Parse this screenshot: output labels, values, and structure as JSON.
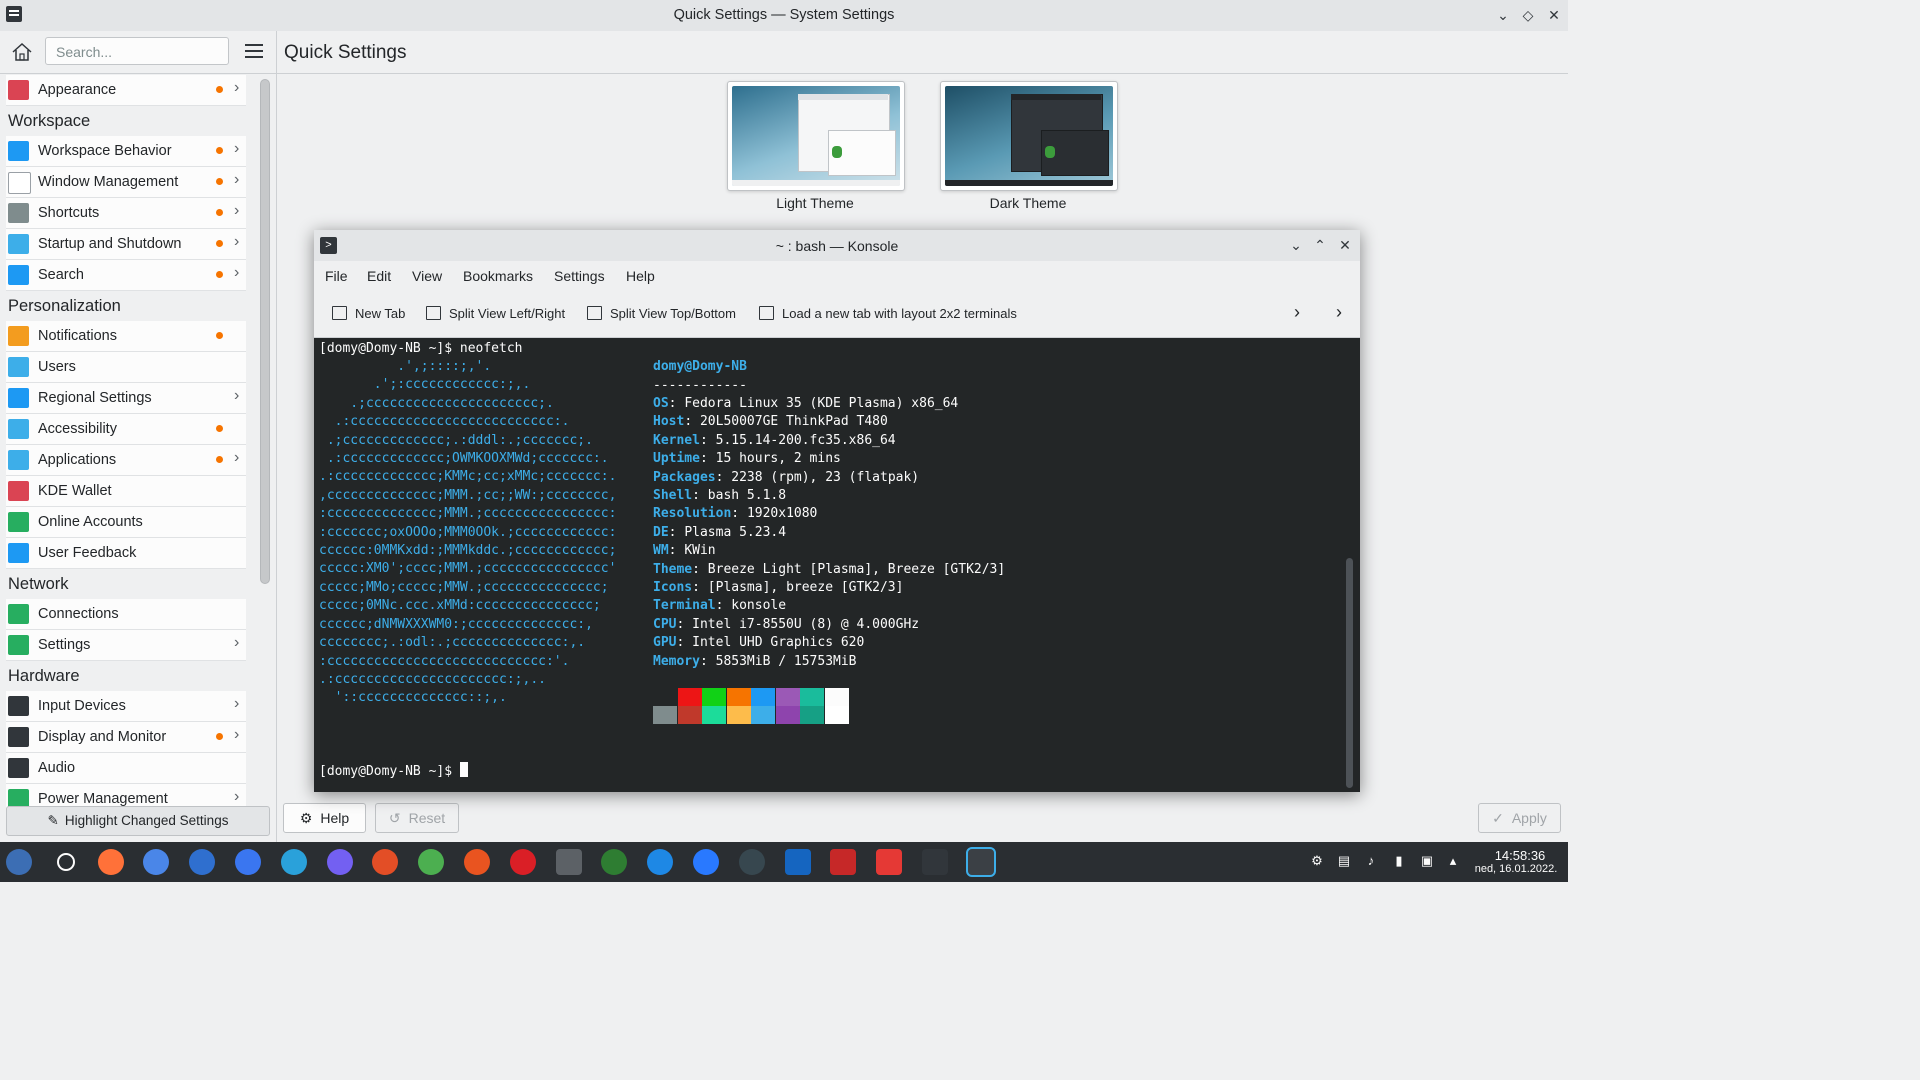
{
  "window": {
    "title": "Quick Settings — System Settings"
  },
  "sidebar": {
    "search_placeholder": "Search...",
    "sections": [
      {
        "heading": "",
        "items": [
          {
            "label": "Appearance",
            "dot": true,
            "chevron": true,
            "icon": "appearance-icon",
            "color": "#da4453"
          }
        ]
      },
      {
        "heading": "Workspace",
        "items": [
          {
            "label": "Workspace Behavior",
            "dot": true,
            "chevron": true,
            "icon": "workspace-icon",
            "color": "#1d99f3"
          },
          {
            "label": "Window Management",
            "dot": true,
            "chevron": true,
            "icon": "window-icon",
            "color": "#ffffff"
          },
          {
            "label": "Shortcuts",
            "dot": true,
            "chevron": true,
            "icon": "keyboard-icon",
            "color": "#7f8c8d"
          },
          {
            "label": "Startup and Shutdown",
            "dot": true,
            "chevron": true,
            "icon": "startup-icon",
            "color": "#3daee9"
          },
          {
            "label": "Search",
            "dot": true,
            "chevron": true,
            "icon": "search-icon",
            "color": "#1d99f3"
          }
        ]
      },
      {
        "heading": "Personalization",
        "items": [
          {
            "label": "Notifications",
            "dot": true,
            "chevron": false,
            "icon": "bell-icon",
            "color": "#f39c1f"
          },
          {
            "label": "Users",
            "dot": false,
            "chevron": false,
            "icon": "users-icon",
            "color": "#3daee9"
          },
          {
            "label": "Regional Settings",
            "dot": false,
            "chevron": true,
            "icon": "regional-icon",
            "color": "#1d99f3"
          },
          {
            "label": "Accessibility",
            "dot": true,
            "chevron": false,
            "icon": "accessibility-icon",
            "color": "#3daee9"
          },
          {
            "label": "Applications",
            "dot": true,
            "chevron": true,
            "icon": "applications-icon",
            "color": "#3daee9"
          },
          {
            "label": "KDE Wallet",
            "dot": false,
            "chevron": false,
            "icon": "wallet-icon",
            "color": "#da4453"
          },
          {
            "label": "Online Accounts",
            "dot": false,
            "chevron": false,
            "icon": "globe-icon",
            "color": "#27ae60"
          },
          {
            "label": "User Feedback",
            "dot": false,
            "chevron": false,
            "icon": "feedback-icon",
            "color": "#1d99f3"
          }
        ]
      },
      {
        "heading": "Network",
        "items": [
          {
            "label": "Connections",
            "dot": false,
            "chevron": false,
            "icon": "globe-icon",
            "color": "#27ae60"
          },
          {
            "label": "Settings",
            "dot": false,
            "chevron": true,
            "icon": "globe-icon",
            "color": "#27ae60"
          }
        ]
      },
      {
        "heading": "Hardware",
        "items": [
          {
            "label": "Input Devices",
            "dot": false,
            "chevron": true,
            "icon": "input-icon",
            "color": "#31363b"
          },
          {
            "label": "Display and Monitor",
            "dot": true,
            "chevron": true,
            "icon": "monitor-icon",
            "color": "#31363b"
          },
          {
            "label": "Audio",
            "dot": false,
            "chevron": false,
            "icon": "speaker-icon",
            "color": "#31363b"
          },
          {
            "label": "Power Management",
            "dot": false,
            "chevron": true,
            "icon": "power-icon",
            "color": "#27ae60"
          }
        ]
      }
    ],
    "highlight_button": "Highlight Changed Settings"
  },
  "main": {
    "title": "Quick Settings",
    "themes": [
      {
        "label": "Light Theme"
      },
      {
        "label": "Dark Theme"
      }
    ],
    "help": "Help",
    "reset": "Reset",
    "apply": "Apply"
  },
  "konsole": {
    "title": "~ : bash — Konsole",
    "menu": [
      "File",
      "Edit",
      "View",
      "Bookmarks",
      "Settings",
      "Help"
    ],
    "toolbar": [
      "New Tab",
      "Split View Left/Right",
      "Split View Top/Bottom",
      "Load a new tab with layout 2x2 terminals"
    ],
    "prompt1": "[domy@Domy-NB ~]$ neofetch",
    "prompt2": "[domy@Domy-NB ~]$ ",
    "logo": [
      "          .',;::::;,'.",
      "       .';:cccccccccccc:;,.",
      "    .;cccccccccccccccccccccc;.",
      "  .:cccccccccccccccccccccccccc:.",
      " .;ccccccccccccc;.:dddl:.;ccccccc;.",
      " .:ccccccccccccc;OWMKOOXMWd;ccccccc:.",
      ".:ccccccccccccc;KMMc;cc;xMMc;ccccccc:.",
      ",cccccccccccccc;MMM.;cc;;WW:;cccccccc,",
      ":cccccccccccccc;MMM.;cccccccccccccccc:",
      ":ccccccc;oxOOOo;MMM0OOk.;cccccccccccc:",
      "cccccc:0MMKxdd:;MMMkddc.;cccccccccccc;",
      "ccccc:XM0';cccc;MMM.;cccccccccccccccc'",
      "ccccc;MMo;ccccc;MMW.;ccccccccccccccc;",
      "ccccc;0MNc.ccc.xMMd:ccccccccccccccc;",
      "cccccc;dNMWXXXWM0:;cccccccccccccc:,",
      "cccccccc;.:odl:.;cccccccccccccc:,.",
      ":cccccccccccccccccccccccccccc:'.",
      ".:cccccccccccccccccccccc:;,..",
      "  '::cccccccccccccc::;,."
    ],
    "info_header": "domy@Domy-NB",
    "info_sep": "------------",
    "info": [
      {
        "k": "OS",
        "v": "Fedora Linux 35 (KDE Plasma) x86_64"
      },
      {
        "k": "Host",
        "v": "20L50007GE ThinkPad T480"
      },
      {
        "k": "Kernel",
        "v": "5.15.14-200.fc35.x86_64"
      },
      {
        "k": "Uptime",
        "v": "15 hours, 2 mins"
      },
      {
        "k": "Packages",
        "v": "2238 (rpm), 23 (flatpak)"
      },
      {
        "k": "Shell",
        "v": "bash 5.1.8"
      },
      {
        "k": "Resolution",
        "v": "1920x1080"
      },
      {
        "k": "DE",
        "v": "Plasma 5.23.4"
      },
      {
        "k": "WM",
        "v": "KWin"
      },
      {
        "k": "Theme",
        "v": "Breeze Light [Plasma], Breeze [GTK2/3]"
      },
      {
        "k": "Icons",
        "v": "[Plasma], breeze [GTK2/3]"
      },
      {
        "k": "Terminal",
        "v": "konsole"
      },
      {
        "k": "CPU",
        "v": "Intel i7-8550U (8) @ 4.000GHz"
      },
      {
        "k": "GPU",
        "v": "Intel UHD Graphics 620"
      },
      {
        "k": "Memory",
        "v": "5853MiB / 15753MiB"
      }
    ],
    "swatches_top": [
      "#232627",
      "#ed1515",
      "#11d116",
      "#f67400",
      "#1d99f3",
      "#9b59b6",
      "#1abc9c",
      "#fcfcfc"
    ],
    "swatches_bottom": [
      "#7f8c8d",
      "#c0392b",
      "#1cdc9a",
      "#fdbc4b",
      "#3daee9",
      "#8e44ad",
      "#16a085",
      "#ffffff"
    ]
  },
  "taskbar": {
    "apps": [
      {
        "name": "fedora-launcher-icon",
        "color": "#3c6eb4"
      },
      {
        "name": "search-icon",
        "color": "#2a2e32"
      },
      {
        "name": "firefox-icon",
        "color": "#ff7139"
      },
      {
        "name": "chromium-icon",
        "color": "#4a86e8"
      },
      {
        "name": "thunderbird-icon",
        "color": "#2f6fcf"
      },
      {
        "name": "signal-icon",
        "color": "#3a76f0"
      },
      {
        "name": "telegram-icon",
        "color": "#2aa1da"
      },
      {
        "name": "viber-icon",
        "color": "#7360f2"
      },
      {
        "name": "downloader-icon",
        "color": "#e34e26"
      },
      {
        "name": "player-icon",
        "color": "#4caf50"
      },
      {
        "name": "gear-app-icon",
        "color": "#e95420"
      },
      {
        "name": "creative-cloud-icon",
        "color": "#da1f26"
      },
      {
        "name": "calculator-icon",
        "color": "#5c6166"
      },
      {
        "name": "plant-icon",
        "color": "#2e7d32"
      },
      {
        "name": "bird-icon",
        "color": "#1e88e5"
      },
      {
        "name": "s-app-icon",
        "color": "#2979ff"
      },
      {
        "name": "connect-icon",
        "color": "#37474f"
      },
      {
        "name": "writer-icon",
        "color": "#1565c0"
      },
      {
        "name": "dc-icon",
        "color": "#c62828"
      },
      {
        "name": "installer-icon",
        "color": "#e53935"
      },
      {
        "name": "settings-app-icon",
        "color": "#31363b"
      },
      {
        "name": "konsole-app-icon",
        "color": "#31363b"
      }
    ],
    "time": "14:58:36",
    "date": "ned, 16.01.2022."
  }
}
